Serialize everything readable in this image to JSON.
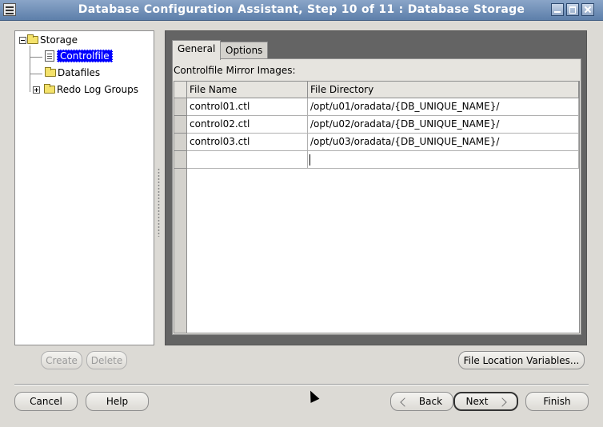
{
  "window": {
    "title": "Database Configuration Assistant, Step 10 of 11 : Database Storage"
  },
  "tree": {
    "root": "Storage",
    "items": [
      {
        "label": "Controlfile",
        "selected": true,
        "icon": "document-icon"
      },
      {
        "label": "Datafiles",
        "icon": "folder-icon"
      },
      {
        "label": "Redo Log Groups",
        "icon": "folder-icon"
      }
    ]
  },
  "tabs": [
    {
      "label": "General",
      "active": true
    },
    {
      "label": "Options",
      "active": false
    }
  ],
  "general": {
    "caption": "Controlfile Mirror Images:",
    "columns": [
      "File Name",
      "File Directory"
    ],
    "rows": [
      {
        "name": "control01.ctl",
        "dir": "/opt/u01/oradata/{DB_UNIQUE_NAME}/"
      },
      {
        "name": "control02.ctl",
        "dir": "/opt/u02/oradata/{DB_UNIQUE_NAME}/"
      },
      {
        "name": "control03.ctl",
        "dir": "/opt/u03/oradata/{DB_UNIQUE_NAME}/"
      },
      {
        "name": "",
        "dir": ""
      }
    ]
  },
  "buttons": {
    "create": "Create",
    "delete": "Delete",
    "file_location": "File Location Variables...",
    "cancel": "Cancel",
    "help": "Help",
    "back": "Back",
    "next": "Next",
    "finish": "Finish"
  },
  "colors": {
    "selection": "#0000ff",
    "panel_bg": "#646464"
  }
}
